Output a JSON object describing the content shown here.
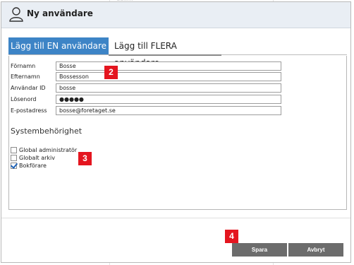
{
  "background": {
    "ghost_text": "ddiiiiii"
  },
  "dialog": {
    "title": "Ny användare",
    "icon": "user-icon",
    "tabs": [
      {
        "label": "Lägg till EN användare",
        "active": true
      },
      {
        "label": "Lägg till FLERA användare",
        "active": false
      }
    ],
    "form": {
      "fields": [
        {
          "label": "Förnamn",
          "value": "Bosse"
        },
        {
          "label": "Efternamn",
          "value": "Bossesson"
        },
        {
          "label": "Användar ID",
          "value": "bosse"
        },
        {
          "label": "Lösenord",
          "value": "●●●●●"
        },
        {
          "label": "E-postadress",
          "value": "bosse@foretaget.se"
        }
      ]
    },
    "permissions": {
      "title": "Systembehörighet",
      "items": [
        {
          "label": "Global administratör",
          "checked": false
        },
        {
          "label": "Globalt arkiv",
          "checked": false
        },
        {
          "label": "Bokförare",
          "checked": true
        }
      ]
    },
    "buttons": {
      "save": "Spara",
      "cancel": "Avbryt"
    },
    "markers": [
      "2",
      "3",
      "4"
    ]
  },
  "colors": {
    "accent": "#3d84c6",
    "marker": "#e4151f",
    "button": "#6c6c6c"
  }
}
